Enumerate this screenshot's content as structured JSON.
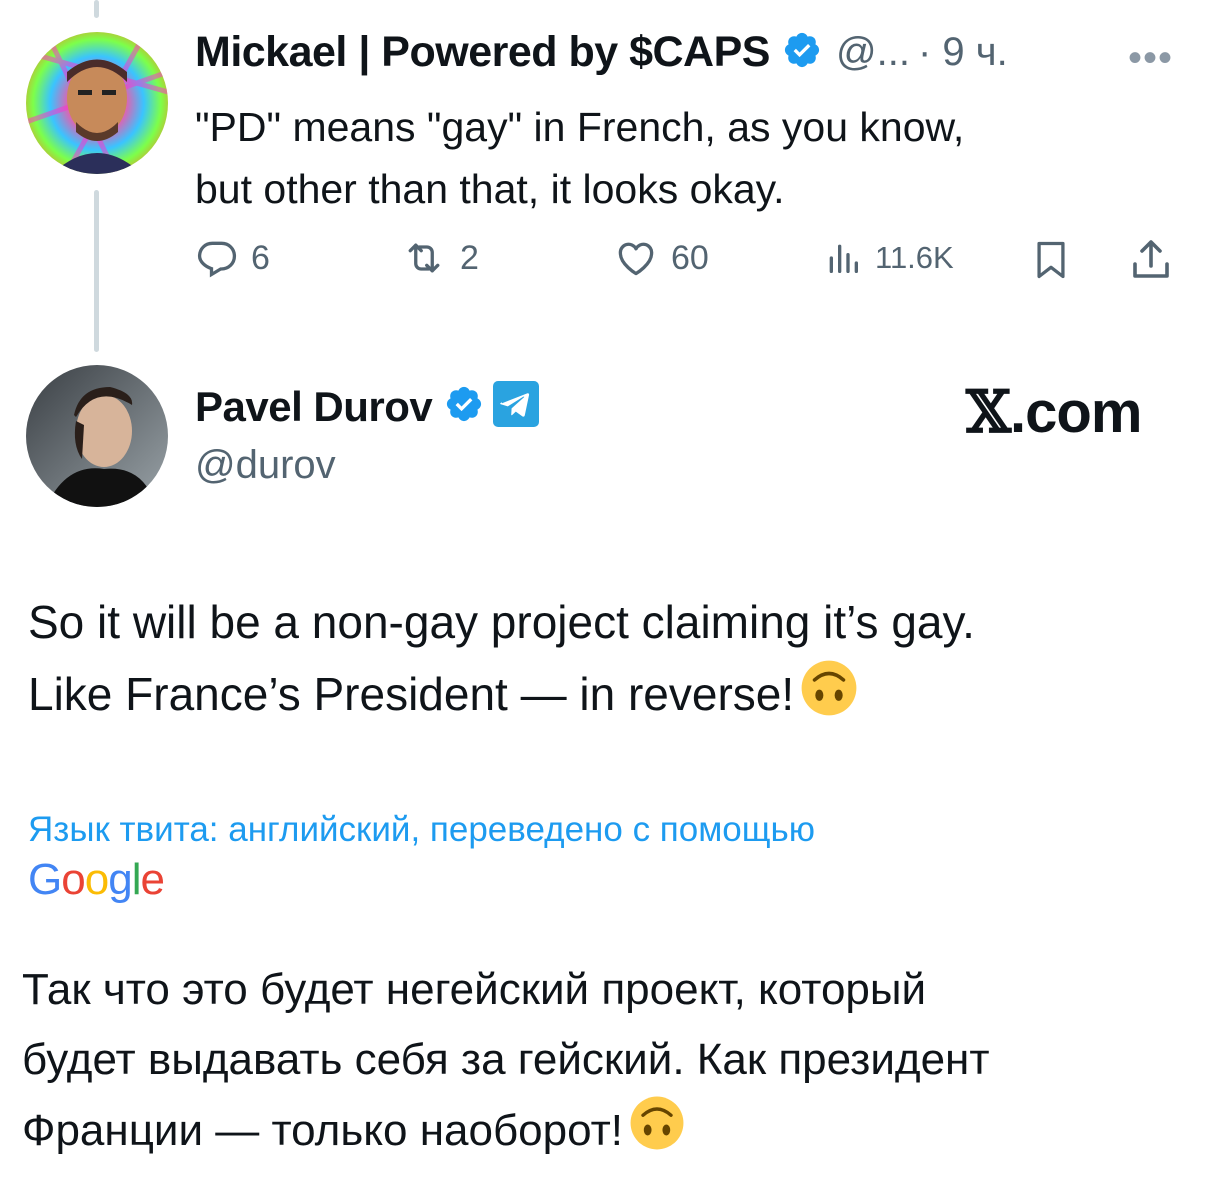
{
  "reply_tweet": {
    "display_name": "Mickael | Powered by $CAPS",
    "handle": "@...",
    "time": "· 9 ч.",
    "more_icon": "more-horizontal-icon",
    "text_line1": "\"PD\" means \"gay\" in French, as you know,",
    "text_line2": "but other than that, it looks okay.",
    "actions": {
      "replies": "6",
      "reposts": "2",
      "likes": "60",
      "views": "11.6K"
    }
  },
  "quoted_tweet": {
    "display_name": "Pavel Durov",
    "handle": "@durov",
    "brand_x": "𝕏",
    "brand_com": ".com",
    "text_line1": "So it will be a non-gay project claiming it’s gay.",
    "text_line2": "Like France’s President — in reverse!",
    "translated_note": "Язык твита: английский, переведено с помощью",
    "translator": {
      "logo_text": "Google",
      "colors": [
        "#4285F4",
        "#EA4335",
        "#FBBC05",
        "#4285F4",
        "#34A853",
        "#EA4335"
      ]
    },
    "translation_line1": "Так что это будет негейский проект, который",
    "translation_line2": "будет выдавать себя за гейский. Как президент",
    "translation_line3": "Франции — только наоборот!"
  },
  "colors": {
    "verified": "#1d9bf0",
    "telegram": "#2aa3e0",
    "link": "#1d9bf0",
    "muted": "#536471",
    "thread_line": "#cfd9de"
  }
}
